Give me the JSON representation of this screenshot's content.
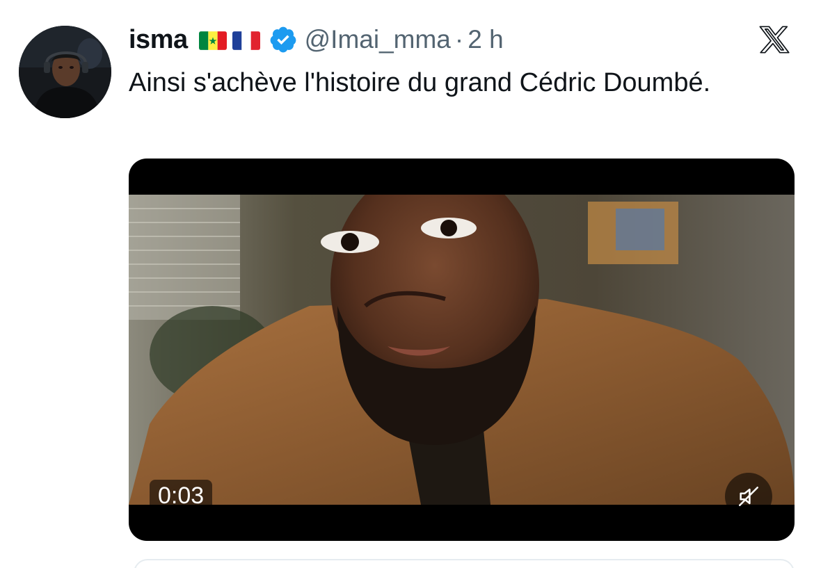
{
  "tweet": {
    "display_name": "isma",
    "flags": [
      "senegal-flag",
      "france-flag"
    ],
    "verified_icon": "verified-badge-icon",
    "handle": "@Imai_mma",
    "separator": "·",
    "time": "2 h",
    "text": "Ainsi s'achève l'histoire du grand Cédric Doumbé."
  },
  "media": {
    "timestamp": "0:03",
    "mute_icon": "speaker-muted-icon"
  },
  "brand": {
    "logo_icon": "x-logo-icon"
  },
  "colors": {
    "text_primary": "#0f1419",
    "text_secondary": "#536471",
    "verified_blue": "#1d9bf0",
    "media_background": "#000000"
  }
}
